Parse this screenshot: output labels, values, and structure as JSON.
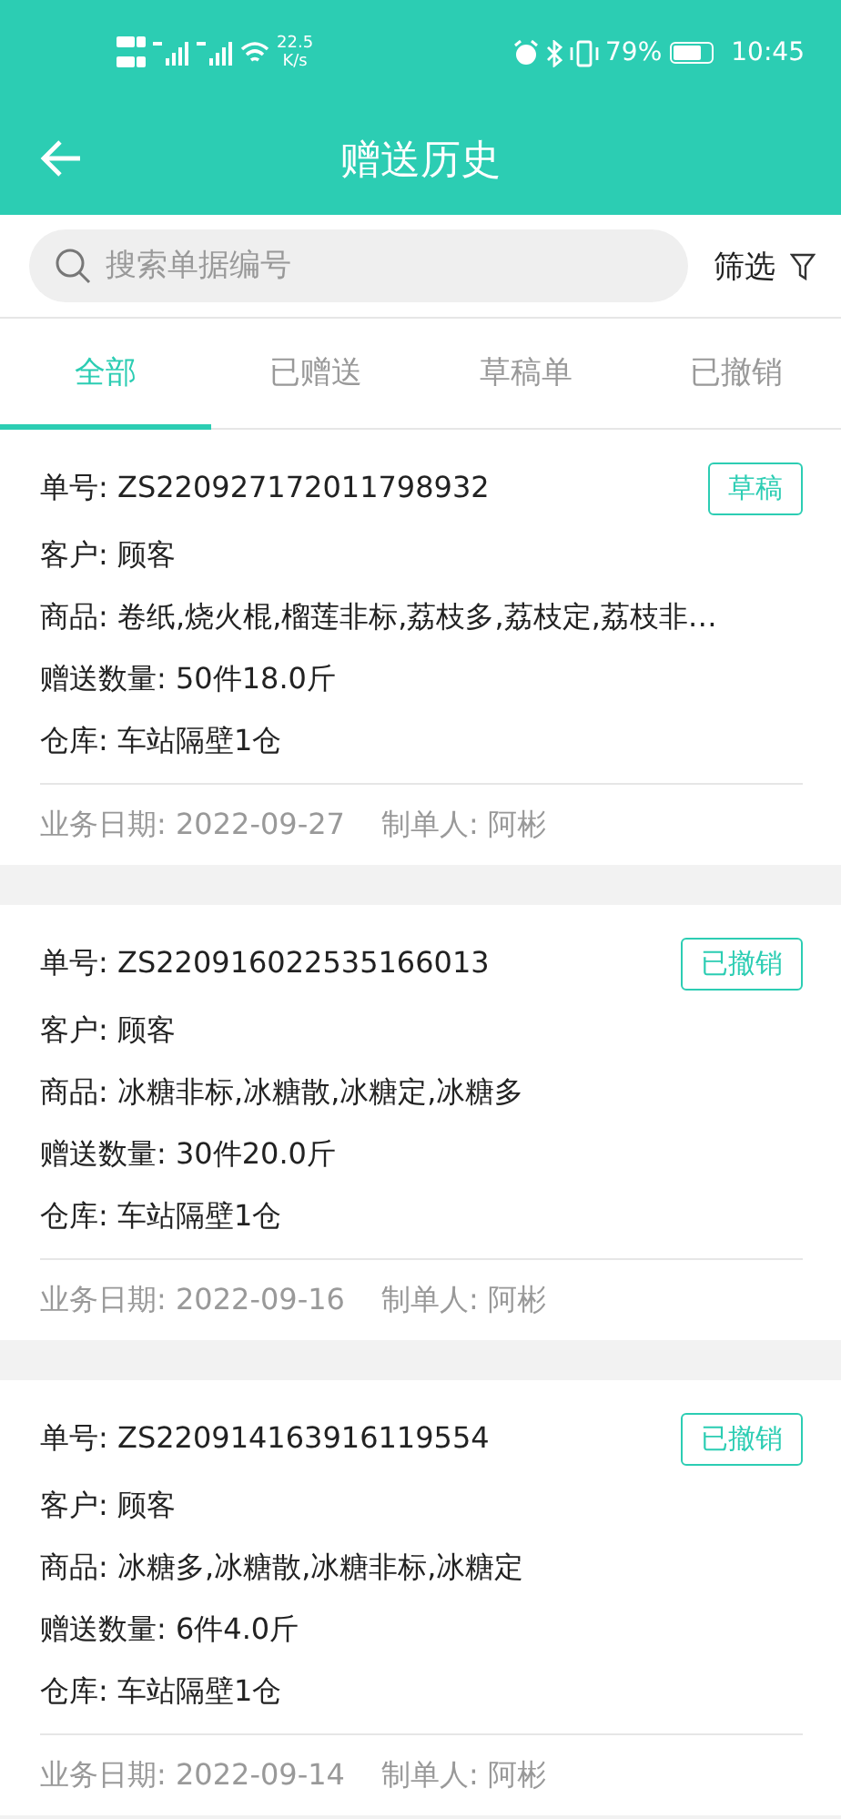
{
  "status_bar": {
    "speed": "22.5",
    "speed_unit": "K/s",
    "battery": "79%",
    "time": "10:45"
  },
  "toolbar": {
    "title": "赠送历史"
  },
  "search": {
    "placeholder": "搜索单据编号",
    "filter": "筛选"
  },
  "tabs": [
    {
      "label": "全部",
      "selected": true
    },
    {
      "label": "已赠送",
      "selected": false
    },
    {
      "label": "草稿单",
      "selected": false
    },
    {
      "label": "已撤销",
      "selected": false
    }
  ],
  "records": [
    {
      "order": "单号: ZS220927172011798932",
      "status": "草稿",
      "customer": "客户: 顾客",
      "goods": "商品: 卷纸,烧火棍,榴莲非标,荔枝多,荔枝定,荔枝非…",
      "quantity": "赠送数量: 50件18.0斤",
      "warehouse": "仓库: 车站隔壁1仓",
      "date": "业务日期: 2022-09-27",
      "maker": "制单人: 阿彬"
    },
    {
      "order": "单号: ZS220916022535166013",
      "status": "已撤销",
      "customer": "客户: 顾客",
      "goods": "商品: 冰糖非标,冰糖散,冰糖定,冰糖多",
      "quantity": "赠送数量: 30件20.0斤",
      "warehouse": "仓库: 车站隔壁1仓",
      "date": "业务日期: 2022-09-16",
      "maker": "制单人: 阿彬"
    },
    {
      "order": "单号: ZS220914163916119554",
      "status": "已撤销",
      "customer": "客户: 顾客",
      "goods": "商品: 冰糖多,冰糖散,冰糖非标,冰糖定",
      "quantity": "赠送数量: 6件4.0斤",
      "warehouse": "仓库: 车站隔壁1仓",
      "date": "业务日期: 2022-09-14",
      "maker": "制单人: 阿彬"
    }
  ]
}
